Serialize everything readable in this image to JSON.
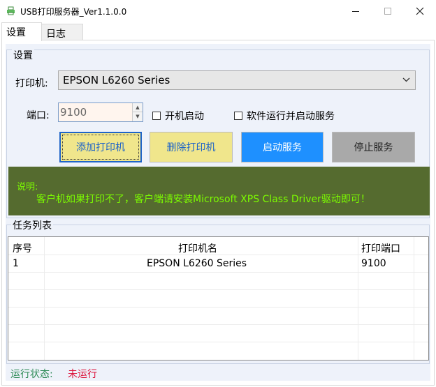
{
  "window": {
    "title": "USB打印服务器_Ver1.1.0.0",
    "minimize_glyph": "—",
    "maximize_glyph": "□",
    "close_glyph": "✕"
  },
  "tabs": [
    {
      "label": "设置",
      "selected": true
    },
    {
      "label": "日志",
      "selected": false
    }
  ],
  "settings": {
    "group_label": "设置",
    "printer_label": "打印机:",
    "printer_value": "EPSON L6260 Series",
    "port_label": "端口:",
    "port_value": "9100",
    "autostart_label": "开机启动",
    "autostart_checked": false,
    "run_service_label": "软件运行并启动服务",
    "run_service_checked": false
  },
  "buttons": {
    "add": "添加打印机",
    "delete": "删除打印机",
    "start": "启动服务",
    "stop": "停止服务"
  },
  "note": {
    "title": "说明:",
    "body": "客户机如果打印不了，客户端请安装Microsoft XPS Class Driver驱动即可！"
  },
  "tasks": {
    "group_label": "任务列表",
    "columns": [
      "序号",
      "打印机名",
      "打印端口"
    ],
    "rows": [
      [
        "1",
        "EPSON L6260 Series",
        "9100"
      ]
    ]
  },
  "status": {
    "label": "运行状态:",
    "value": "未运行"
  },
  "colors": {
    "yellow_button": "#f0e68c",
    "start_button": "#1e90ff",
    "stop_button": "#a9a9a9",
    "note_background": "#556b2f",
    "note_text": "#7cfc00",
    "status_stopped": "#dc143c"
  }
}
